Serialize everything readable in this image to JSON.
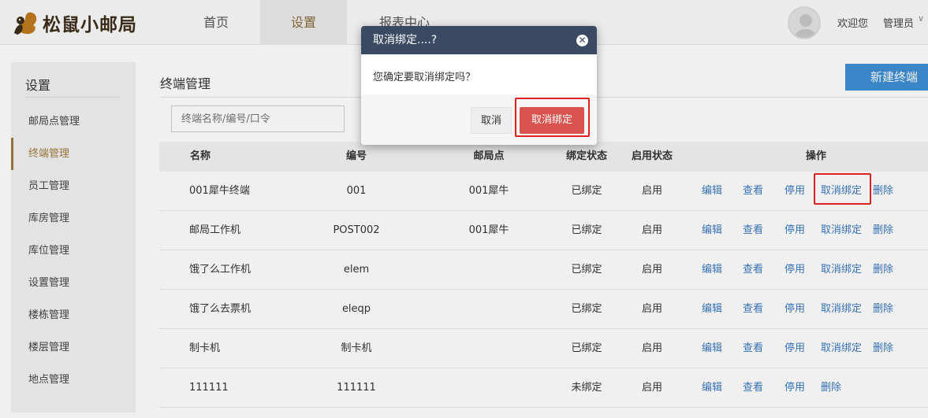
{
  "app": {
    "logo_text": "松鼠小邮局"
  },
  "nav": {
    "items": [
      {
        "label": "首页"
      },
      {
        "label": "设置"
      },
      {
        "label": "报表中心"
      }
    ]
  },
  "user": {
    "welcome": "欢迎您",
    "name": "管理员",
    "caret": "∨"
  },
  "sidebar": {
    "title": "设置",
    "items": [
      {
        "label": "邮局点管理"
      },
      {
        "label": "终端管理"
      },
      {
        "label": "员工管理"
      },
      {
        "label": "库房管理"
      },
      {
        "label": "库位管理"
      },
      {
        "label": "设置管理"
      },
      {
        "label": "楼栋管理"
      },
      {
        "label": "楼层管理"
      },
      {
        "label": "地点管理"
      }
    ],
    "active_index": 1
  },
  "main": {
    "title": "终端管理",
    "new_button": "新建终端",
    "search_placeholder": "终端名称/编号/口令"
  },
  "table": {
    "headers": [
      "名称",
      "编号",
      "邮局点",
      "绑定状态",
      "启用状态",
      "操作"
    ],
    "rows": [
      {
        "name": "001犀牛终端",
        "code": "001",
        "post": "001犀牛",
        "bind": "已绑定",
        "enable": "启用",
        "ops": [
          "编辑",
          "查看",
          "停用",
          "取消绑定",
          "删除"
        ]
      },
      {
        "name": "邮局工作机",
        "code": "POST002",
        "post": "001犀牛",
        "bind": "已绑定",
        "enable": "启用",
        "ops": [
          "编辑",
          "查看",
          "停用",
          "取消绑定",
          "删除"
        ]
      },
      {
        "name": "饿了么工作机",
        "code": "elem",
        "post": "",
        "bind": "已绑定",
        "enable": "启用",
        "ops": [
          "编辑",
          "查看",
          "停用",
          "取消绑定",
          "删除"
        ]
      },
      {
        "name": "饿了么去票机",
        "code": "eleqp",
        "post": "",
        "bind": "已绑定",
        "enable": "启用",
        "ops": [
          "编辑",
          "查看",
          "停用",
          "取消绑定",
          "删除"
        ]
      },
      {
        "name": "制卡机",
        "code": "制卡机",
        "post": "",
        "bind": "已绑定",
        "enable": "启用",
        "ops": [
          "编辑",
          "查看",
          "停用",
          "取消绑定",
          "删除"
        ]
      },
      {
        "name": "111111",
        "code": "111111",
        "post": "",
        "bind": "未绑定",
        "enable": "启用",
        "ops": [
          "编辑",
          "查看",
          "停用",
          "删除"
        ]
      }
    ]
  },
  "dialog": {
    "title": "取消绑定....?",
    "close_glyph": "✕",
    "message": "您确定要取消绑定吗？",
    "cancel_label": "取消",
    "confirm_label": "取消绑定"
  },
  "colors": {
    "link": "#3a79c2",
    "danger": "#d9534f",
    "dialog_header": "#3b4a63",
    "accent": "#a07a3c",
    "primary": "#3f8fd6",
    "highlight": "#e02020"
  }
}
